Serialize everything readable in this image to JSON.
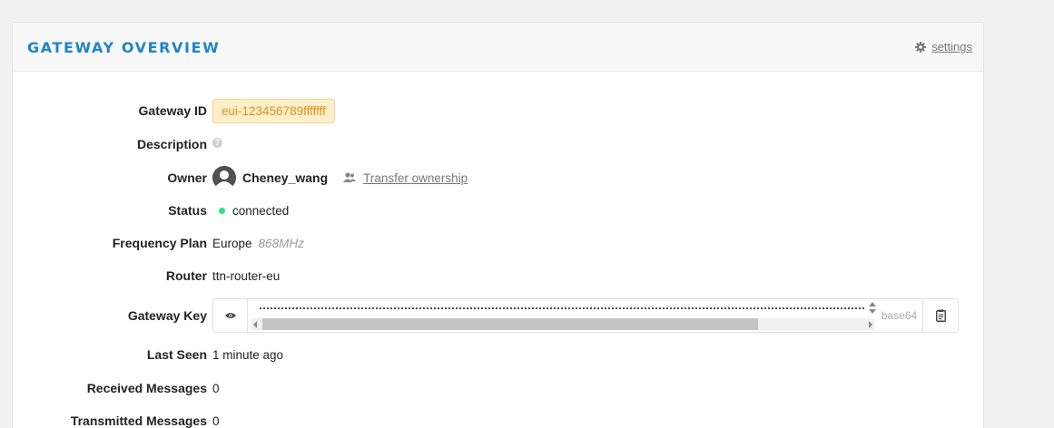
{
  "header": {
    "title": "GATEWAY OVERVIEW",
    "settings_label": "settings",
    "settings_icon": "gear-icon"
  },
  "fields": {
    "gateway_id": {
      "label": "Gateway ID",
      "value": "eui-123456789fffffff"
    },
    "description": {
      "label": "Description",
      "help_icon": "question-icon"
    },
    "owner": {
      "label": "Owner",
      "name": "Cheney_wang",
      "transfer_label": "Transfer ownership",
      "avatar_icon": "avatar-icon",
      "transfer_icon": "users-icon"
    },
    "status": {
      "label": "Status",
      "value": "connected",
      "color": "#2fe37a"
    },
    "frequency_plan": {
      "label": "Frequency Plan",
      "value": "Europe",
      "sub": "868MHz"
    },
    "router": {
      "label": "Router",
      "value": "ttn-router-eu"
    },
    "gateway_key": {
      "label": "Gateway Key",
      "encoding": "base64",
      "eye_icon": "eye-icon",
      "copy_icon": "clipboard-icon"
    },
    "last_seen": {
      "label": "Last Seen",
      "value": "1 minute ago"
    },
    "received_messages": {
      "label": "Received Messages",
      "value": "0"
    },
    "transmitted_messages": {
      "label": "Transmitted Messages",
      "value": "0"
    }
  },
  "colors": {
    "accent": "#1f86c6",
    "badge_bg": "#fcefc9",
    "badge_text": "#e0901e"
  }
}
